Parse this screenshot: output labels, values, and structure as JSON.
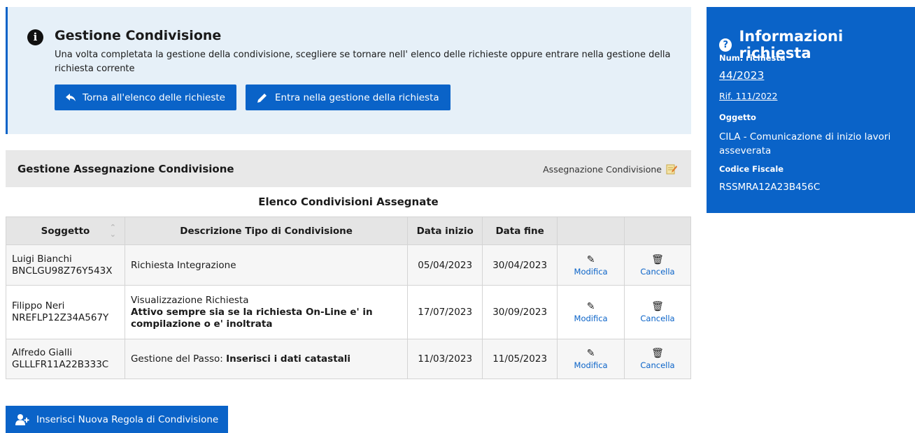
{
  "info_box": {
    "title": "Gestione Condivisione",
    "text": "Una volta completata la gestione della condivisione, scegliere se tornare nell' elenco delle richieste oppure entrare nella gestione della richiesta corrente",
    "back_button": "Torna all'elenco delle richieste",
    "enter_button": "Entra nella gestione della richiesta"
  },
  "section": {
    "title": "Gestione Assegnazione Condivisione",
    "link": "Assegnazione Condivisione"
  },
  "list_title": "Elenco Condivisioni Assegnate",
  "table": {
    "headers": [
      "Soggetto",
      "Descrizione Tipo di Condivisione",
      "Data inizio",
      "Data fine",
      "",
      ""
    ],
    "rows": [
      {
        "name": "Luigi Bianchi",
        "code": "BNCLGU98Z76Y543X",
        "desc": "Richiesta Integrazione",
        "desc_bold": "",
        "start": "05/04/2023",
        "end": "30/04/2023"
      },
      {
        "name": "Filippo Neri",
        "code": "NREFLP12Z34A567Y",
        "desc": "Visualizzazione Richiesta",
        "desc_bold": "Attivo sempre sia se la richiesta On-Line e' in compilazione o e' inoltrata",
        "start": "17/07/2023",
        "end": "30/09/2023"
      },
      {
        "name": "Alfredo Gialli",
        "code": "GLLLFR11A22B333C",
        "desc": "Gestione del Passo: ",
        "desc_bold": "Inserisci i dati catastali",
        "start": "11/03/2023",
        "end": "11/05/2023"
      }
    ],
    "edit_label": "Modifica",
    "delete_label": "Cancella"
  },
  "add_button": "Inserisci Nuova Regola di Condivisione",
  "card": {
    "title": "Informazioni richiesta",
    "num_label": "Num. richiesta",
    "num_value": "44/2023",
    "rif": "Rif. 111/2022",
    "oggetto_label": "Oggetto",
    "oggetto_value": "CILA - Comunicazione di inizio lavori asseverata",
    "cf_label": "Codice Fiscale",
    "cf_value": "RSSMRA12A23B456C"
  },
  "colors": {
    "primary": "#0a63c8",
    "info_bg": "#e6f0f8",
    "header_bg": "#e8e8e8"
  },
  "icons": [
    "info-icon",
    "reply-arrow-icon",
    "pencil-icon",
    "sort-icon",
    "edit-note-icon",
    "trash-icon",
    "add-user-icon",
    "question-icon"
  ]
}
